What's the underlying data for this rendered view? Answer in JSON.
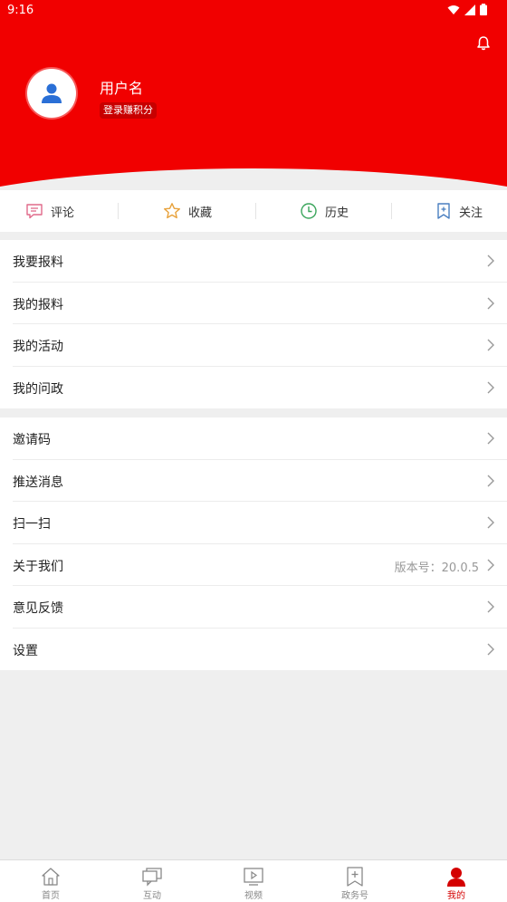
{
  "status_bar": {
    "time": "9:16"
  },
  "profile": {
    "username": "用户名",
    "login_badge": "登录赚积分"
  },
  "quick_actions": [
    {
      "label": "评论",
      "icon": "comment-icon"
    },
    {
      "label": "收藏",
      "icon": "star-icon"
    },
    {
      "label": "历史",
      "icon": "clock-icon"
    },
    {
      "label": "关注",
      "icon": "bookmark-plus-icon"
    }
  ],
  "menu_group_1": [
    {
      "label": "我要报料"
    },
    {
      "label": "我的报料"
    },
    {
      "label": "我的活动"
    },
    {
      "label": "我的问政"
    }
  ],
  "menu_group_2": [
    {
      "label": "邀请码"
    },
    {
      "label": "推送消息"
    },
    {
      "label": "扫一扫"
    },
    {
      "label": "关于我们",
      "value": "版本号：20.0.5"
    },
    {
      "label": "意见反馈"
    },
    {
      "label": "设置"
    }
  ],
  "tabbar": {
    "items": [
      {
        "label": "首页",
        "icon": "home-icon"
      },
      {
        "label": "互动",
        "icon": "chat-icon"
      },
      {
        "label": "视频",
        "icon": "video-icon"
      },
      {
        "label": "政务号",
        "icon": "gov-bookmark-icon"
      },
      {
        "label": "我的",
        "icon": "user-icon"
      }
    ],
    "active": "我的"
  },
  "colors": {
    "brand_red": "#f10000",
    "active_tab": "#d40000",
    "background": "#efefef"
  }
}
